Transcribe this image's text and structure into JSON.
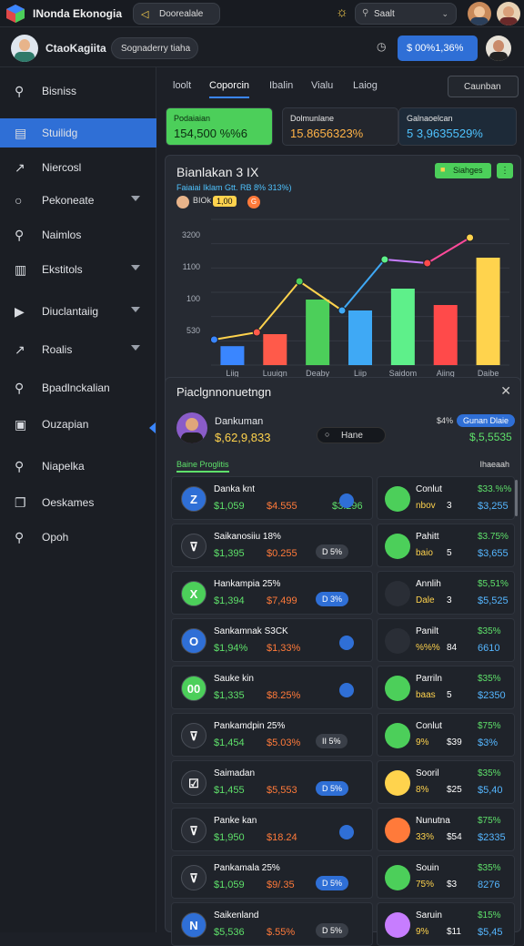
{
  "header": {
    "title": "INonda Ekonogia",
    "doc_label": "Doorealale",
    "search_placeholder": "Saalt"
  },
  "subheader": {
    "name": "CtaoKagiita",
    "pill": "Sognaderry tiaha",
    "balance": "$ 00%1,36%"
  },
  "sidebar": {
    "items": [
      {
        "label": "Bisniss",
        "icon": "search-icon"
      },
      {
        "label": "Stuilidg",
        "icon": "chart-icon",
        "active": true
      },
      {
        "label": "Niercosl",
        "icon": "trend-icon"
      },
      {
        "label": "Pekoneate",
        "icon": "circle-icon",
        "chevron": true
      },
      {
        "label": "Naimlos",
        "icon": "pin-icon"
      },
      {
        "label": "Ekstitols",
        "icon": "bar-chart-icon",
        "chevron": true
      },
      {
        "label": "Diuclantaiig",
        "icon": "play-icon",
        "chevron": true
      },
      {
        "label": "Roalis",
        "icon": "line-chart-icon",
        "chevron": true
      },
      {
        "label": "Bpadlnckalian",
        "icon": "search-icon"
      },
      {
        "label": "Ouzapian",
        "icon": "grid-icon"
      },
      {
        "label": "Niapelka",
        "icon": "pin-icon"
      },
      {
        "label": "Oeskames",
        "icon": "copy-icon"
      },
      {
        "label": "Opoh",
        "icon": "pin-icon"
      }
    ]
  },
  "tabs": [
    "loolt",
    "Coporcin",
    "Ibalin",
    "Vialu",
    "Laiog"
  ],
  "tab_button": "Caunban",
  "stats": [
    {
      "title": "Podaiaian",
      "value": "154,500 %%6",
      "bg": "#4ccf5a",
      "fg": "#0b2a10"
    },
    {
      "title": "Dolmunlane",
      "value": "15.8656323%",
      "bg": "#23262d",
      "fg": "#ffb347"
    },
    {
      "title": "Galnaoelcan",
      "value": "5 3,9635529%",
      "bg": "#1d2a38",
      "fg": "#4fc3ff"
    }
  ],
  "chart": {
    "title": "Bianlakan 3 IX",
    "subtitle": "Faiaiai Iklam Gtt. RB 8% 313%)",
    "legend_btn": "Siahges",
    "chips": [
      "BIOk",
      "1,00",
      "G"
    ]
  },
  "chart_data": {
    "type": "bar",
    "categories": [
      "Liig",
      "Luuign",
      "Deaby",
      "Liip",
      "Saidom",
      "Aiing",
      "Daibe"
    ],
    "series": [
      {
        "values": [
          520,
          850,
          1800,
          1500,
          2100,
          1650,
          2950
        ]
      }
    ],
    "line": [
      {
        "values": [
          700,
          900,
          2300,
          1500,
          2900,
          2800,
          3500
        ]
      }
    ],
    "bar_colors": [
      "#3a86ff",
      "#ff5a4a",
      "#4ccf5a",
      "#3fa9f5",
      "#5ef08a",
      "#ff4a4a",
      "#ffd34d"
    ],
    "yticks": [
      "3200",
      "1100",
      "100",
      "530"
    ],
    "ylim": [
      0,
      4000
    ]
  },
  "panel": {
    "title": "Piaclgnnonuetngn",
    "user": "Dankuman",
    "amount": "$,62,9,833",
    "toggle": "Hane",
    "pct": "$4%",
    "badge": "Gunan Dlaie",
    "right_value": "$,5,5535",
    "section": "Baine Proglitis",
    "section_right": "Ihaeaah"
  },
  "rows": [
    {
      "icon": "Z",
      "color": "#2f6fd6",
      "name": "Danka knt",
      "v1": "$1,059",
      "v2": "$4.555",
      "v3": "$3.296",
      "tag": "",
      "r_name": "Conlut",
      "r_sub": "nbov",
      "r_n": "3",
      "r_top": "$33.%%",
      "r_val": "$3,255",
      "r_color": "#4ccf5a"
    },
    {
      "icon": "⊽",
      "color": "#2a2e36",
      "name": "Saikanosiiu 18%",
      "v1": "$1,395",
      "v2": "$0.255",
      "v3": "",
      "tag": "D 5%",
      "r_name": "Pahitt",
      "r_sub": "baio",
      "r_n": "5",
      "r_top": "$3.75%",
      "r_val": "$3,655",
      "r_color": "#4ccf5a"
    },
    {
      "icon": "X",
      "color": "#4ccf5a",
      "name": "Hankampia 25%",
      "v1": "$1,394",
      "v2": "$7,499",
      "v3": "",
      "tag": "D 3%",
      "r_name": "Annlih",
      "r_sub": "Dale",
      "r_n": "3",
      "r_top": "$5,51%",
      "r_val": "$5,525",
      "r_color": "#2a2e36"
    },
    {
      "icon": "O",
      "color": "#2f6fd6",
      "name": "Sankamnak S3CK",
      "v1": "$1,94%",
      "v2": "$1,33%",
      "v3": "",
      "tag": "",
      "r_name": "Panilt",
      "r_sub": "%%%",
      "r_n": "84",
      "r_top": "$35%",
      "r_val": "6610",
      "r_color": "#2a2e36"
    },
    {
      "icon": "00",
      "color": "#4ccf5a",
      "name": "Sauke kin",
      "v1": "$1,335",
      "v2": "$8.25%",
      "v3": "",
      "tag": "",
      "r_name": "Parriln",
      "r_sub": "baas",
      "r_n": "5",
      "r_top": "$35%",
      "r_val": "$2350",
      "r_color": "#4ccf5a"
    },
    {
      "icon": "⊽",
      "color": "#2a2e36",
      "name": "Pankamdpin 25%",
      "v1": "$1,454",
      "v2": "$5.03%",
      "v3": "",
      "tag": "II 5%",
      "r_name": "Conlut",
      "r_sub": "9%",
      "r_n": "$39",
      "r_top": "$75%",
      "r_val": "$3%",
      "r_color": "#4ccf5a"
    },
    {
      "icon": "☑",
      "color": "#2a2e36",
      "name": "Saimadan",
      "v1": "$1,455",
      "v2": "$5,553",
      "v3": "",
      "tag": "D 5%",
      "r_name": "Sooril",
      "r_sub": "8%",
      "r_n": "$25",
      "r_top": "$35%",
      "r_val": "$5,40",
      "r_color": "#ffd34d"
    },
    {
      "icon": "⊽",
      "color": "#2a2e36",
      "name": "Panke kan",
      "v1": "$1,950",
      "v2": "$18.24",
      "v3": "",
      "tag": "",
      "r_name": "Nunutna",
      "r_sub": "33%",
      "r_n": "$54",
      "r_top": "$75%",
      "r_val": "$2335",
      "r_color": "#ff7a3a"
    },
    {
      "icon": "⊽",
      "color": "#2a2e36",
      "name": "Pankamala 25%",
      "v1": "$1,059",
      "v2": "$9/.35",
      "v3": "",
      "tag": "D 5%",
      "r_name": "Souin",
      "r_sub": "75%",
      "r_n": "$3",
      "r_top": "$35%",
      "r_val": "8276",
      "r_color": "#4ccf5a"
    },
    {
      "icon": "N",
      "color": "#2f6fd6",
      "name": "Saikenland",
      "v1": "$5,536",
      "v2": "$.55%",
      "v3": "",
      "tag": "D 5%",
      "r_name": "Saruin",
      "r_sub": "9%",
      "r_n": "$11",
      "r_top": "$15%",
      "r_val": "$5,45",
      "r_color": "#c77dff"
    }
  ]
}
